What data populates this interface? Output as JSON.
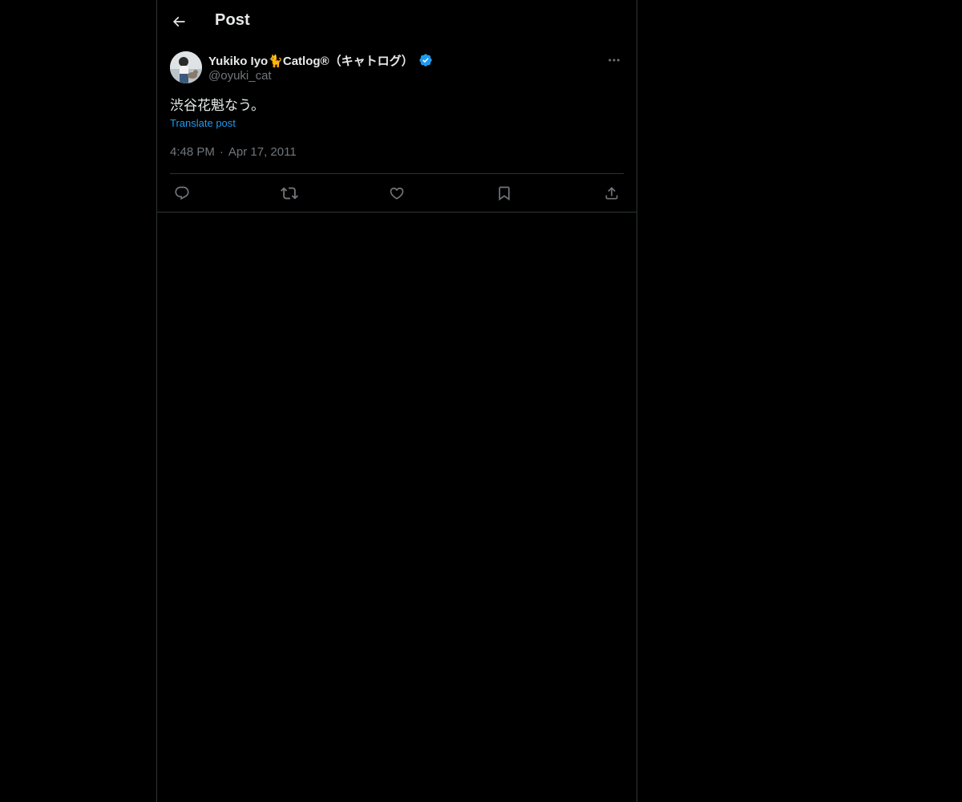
{
  "header": {
    "title": "Post",
    "back_icon": "arrow-left-icon"
  },
  "post": {
    "author": {
      "display_name": "Yukiko Iyo🐈Catlog®（キャトログ）",
      "handle": "@oyuki_cat",
      "verified": true,
      "verified_color": "#1d9bf0"
    },
    "text": "渋谷花魁なう。",
    "translate_label": "Translate post",
    "time": "4:48 PM",
    "separator": "·",
    "date": "Apr 17, 2011"
  },
  "actions": [
    {
      "name": "reply",
      "icon": "reply-icon"
    },
    {
      "name": "repost",
      "icon": "repost-icon"
    },
    {
      "name": "like",
      "icon": "heart-icon"
    },
    {
      "name": "bookmark",
      "icon": "bookmark-icon"
    },
    {
      "name": "share",
      "icon": "share-icon"
    }
  ],
  "colors": {
    "background": "#000000",
    "text_primary": "#e7e9ea",
    "text_secondary": "#71767b",
    "accent": "#1d9bf0",
    "border": "#2f3336"
  }
}
